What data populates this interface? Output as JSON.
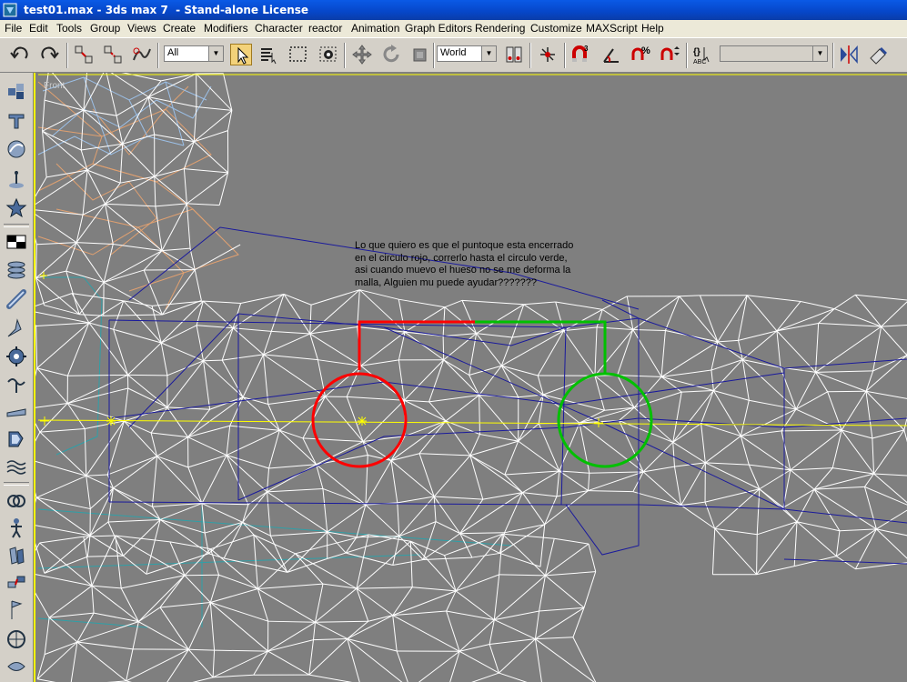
{
  "window": {
    "title": "test01.max - 3ds max 7  - Stand-alone License"
  },
  "menu": {
    "items": [
      "File",
      "Edit",
      "Tools",
      "Group",
      "Views",
      "Create",
      "Modifiers",
      "Character",
      "reactor",
      "Animation",
      "Graph Editors",
      "Rendering",
      "Customize",
      "MAXScript",
      "Help"
    ]
  },
  "toolbar": {
    "selection_filter": "All",
    "reference_coord_system": "World",
    "snap_angle_label": "3",
    "named_selection_sets": "",
    "buttons": [
      "undo-icon",
      "redo-icon",
      "select-and-link-icon",
      "unlink-selection-icon",
      "bind-to-space-warp-icon",
      "select-object-icon",
      "select-by-name-icon",
      "rectangular-selection-region-icon",
      "window-crossing-icon",
      "select-and-move-icon",
      "select-and-rotate-icon",
      "select-and-scale-icon",
      "use-pivot-point-center-icon",
      "select-and-manipulate-icon",
      "snaps-toggle-icon",
      "angle-snap-icon",
      "percent-snap-icon",
      "spinner-snap-icon",
      "edit-named-selection-sets-icon",
      "mirror-icon",
      "align-icon"
    ]
  },
  "command_panel_tabs": [
    "create-icon",
    "modify-icon",
    "hierarchy-icon",
    "motion-icon",
    "display-icon"
  ],
  "viewport": {
    "label": "Front",
    "annotation_lines": [
      "Lo que quiero es que el puntoque esta encerrado",
      "en el circulo rojo, correrlo hasta el circulo verde,",
      "asi cuando muevo el hueso no se me deforma la",
      "malla, Alguien mu puede ayudar???????"
    ]
  },
  "colors": {
    "viewport_bg": "#7f7f7f",
    "active_viewport_border": "#ffff00",
    "mesh_white": "#ffffff",
    "mesh_blue": "#1a1aa0",
    "bone_line": "#ffff00",
    "red_marker": "#ff0000",
    "green_marker": "#00c000",
    "title_bar": "#0a4fd8",
    "menu_bg": "#ece9d8",
    "toolbar_bg": "#d4d0c8",
    "active_tool": "#f3d27a"
  }
}
